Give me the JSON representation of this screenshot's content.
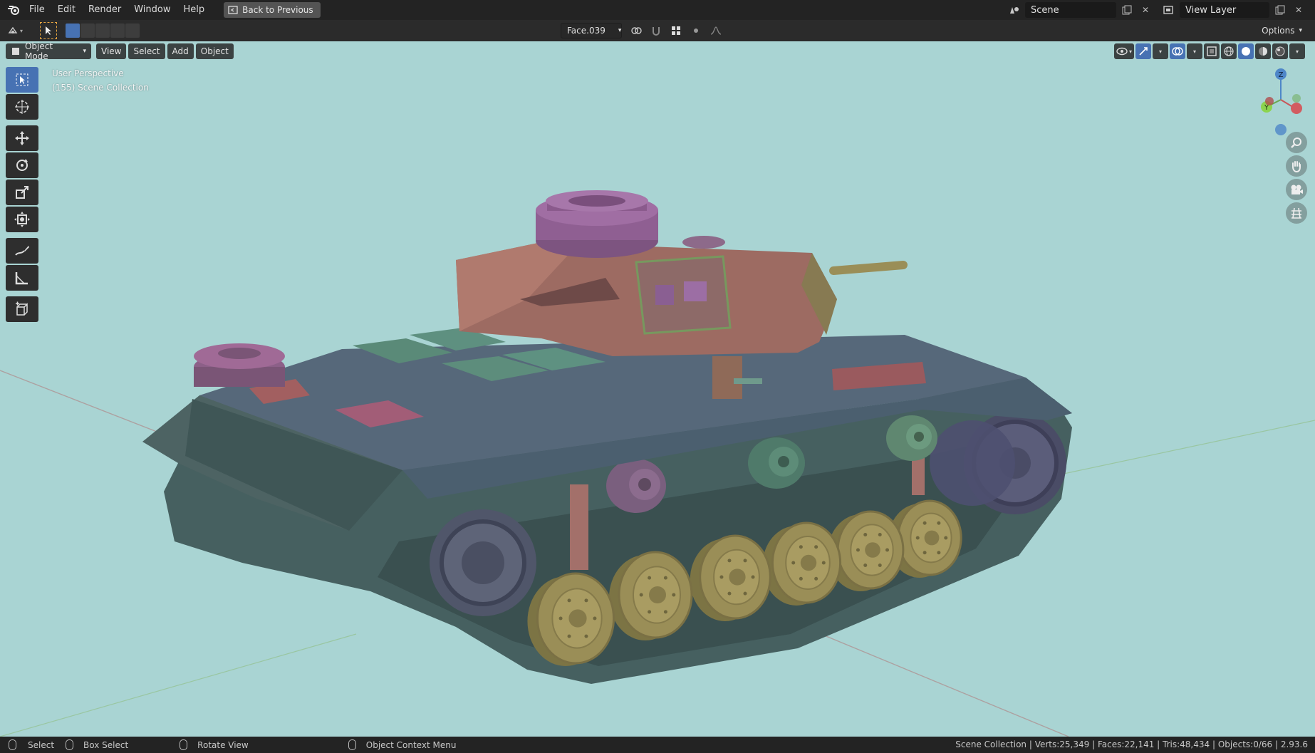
{
  "menu": {
    "items": [
      "File",
      "Edit",
      "Render",
      "Window",
      "Help"
    ],
    "back_button": "Back to Previous"
  },
  "scene": {
    "name": "Scene",
    "view_layer": "View Layer"
  },
  "toolrow": {
    "face_dropdown": "Face.039",
    "options_label": "Options"
  },
  "viewport_header": {
    "mode": "Object Mode",
    "view": "View",
    "select": "Select",
    "add": "Add",
    "object": "Object"
  },
  "overlay": {
    "perspective": "User Perspective",
    "collection": "(155) Scene Collection"
  },
  "gizmo": {
    "z": "Z",
    "y": "Y"
  },
  "status": {
    "select": "Select",
    "box_select": "Box Select",
    "rotate_view": "Rotate View",
    "context_menu": "Object Context Menu",
    "stats": "Scene Collection | Verts:25,349 | Faces:22,141 | Tris:48,434 | Objects:0/66 | 2.93.6"
  },
  "colors": {
    "viewport_bg": "#a9d4d3",
    "hull": "#4a6464",
    "turret": "#9a6a62",
    "wheels": "#9a8e57",
    "accent": "#4772b3"
  },
  "icons": [
    "blender-logo",
    "select-box-icon",
    "cursor-icon",
    "move-icon",
    "rotate-icon",
    "scale-icon",
    "transform-icon",
    "annotate-icon",
    "measure-icon",
    "add-cube-icon",
    "zoom-icon",
    "hand-icon",
    "camera-icon",
    "grid-icon"
  ]
}
